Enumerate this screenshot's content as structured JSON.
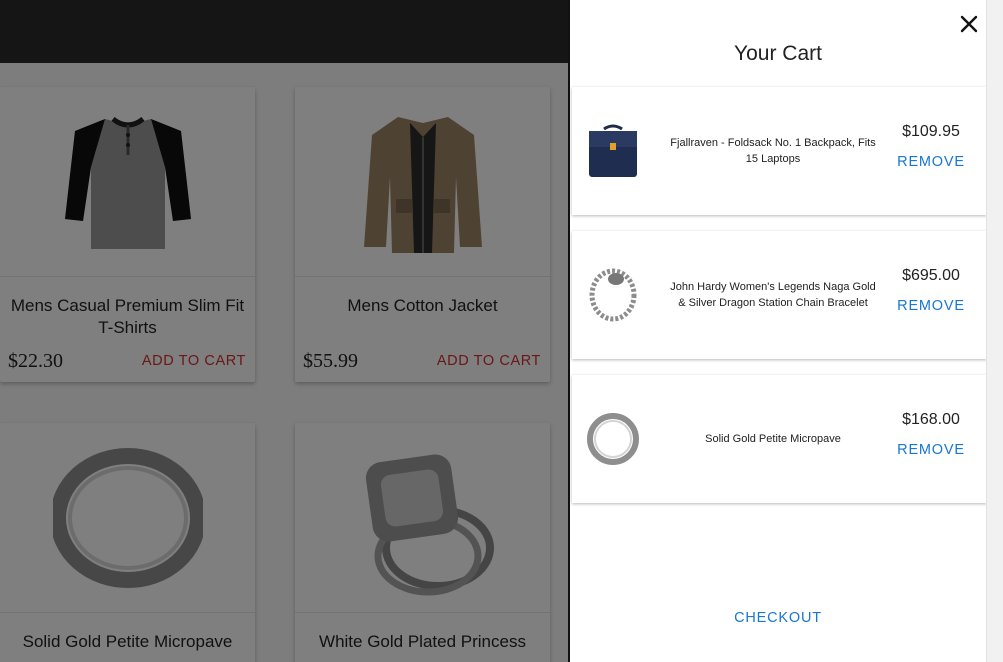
{
  "products": [
    {
      "title": "Mens Casual Premium Slim Fit T-Shirts",
      "price": "$22.30",
      "action": "ADD TO CART"
    },
    {
      "title": "Mens Cotton Jacket",
      "price": "$55.99",
      "action": "ADD TO CART"
    },
    {
      "title": "Solid Gold Petite Micropave",
      "price": "",
      "action": ""
    },
    {
      "title": "White Gold Plated Princess",
      "price": "",
      "action": ""
    }
  ],
  "cart": {
    "title": "Your Cart",
    "close_icon": "close-icon",
    "items": [
      {
        "name": "Fjallraven - Foldsack No. 1 Backpack, Fits 15 Laptops",
        "price": "$109.95",
        "remove_label": "REMOVE"
      },
      {
        "name": "John Hardy Women's Legends Naga Gold & Silver Dragon Station Chain Bracelet",
        "price": "$695.00",
        "remove_label": "REMOVE"
      },
      {
        "name": "Solid Gold Petite Micropave",
        "price": "$168.00",
        "remove_label": "REMOVE"
      }
    ],
    "checkout_label": "CHECKOUT"
  },
  "colors": {
    "accent_blue": "#1976d2",
    "add_to_cart_red": "#d32f2f",
    "topbar": "#2b2b2b"
  }
}
